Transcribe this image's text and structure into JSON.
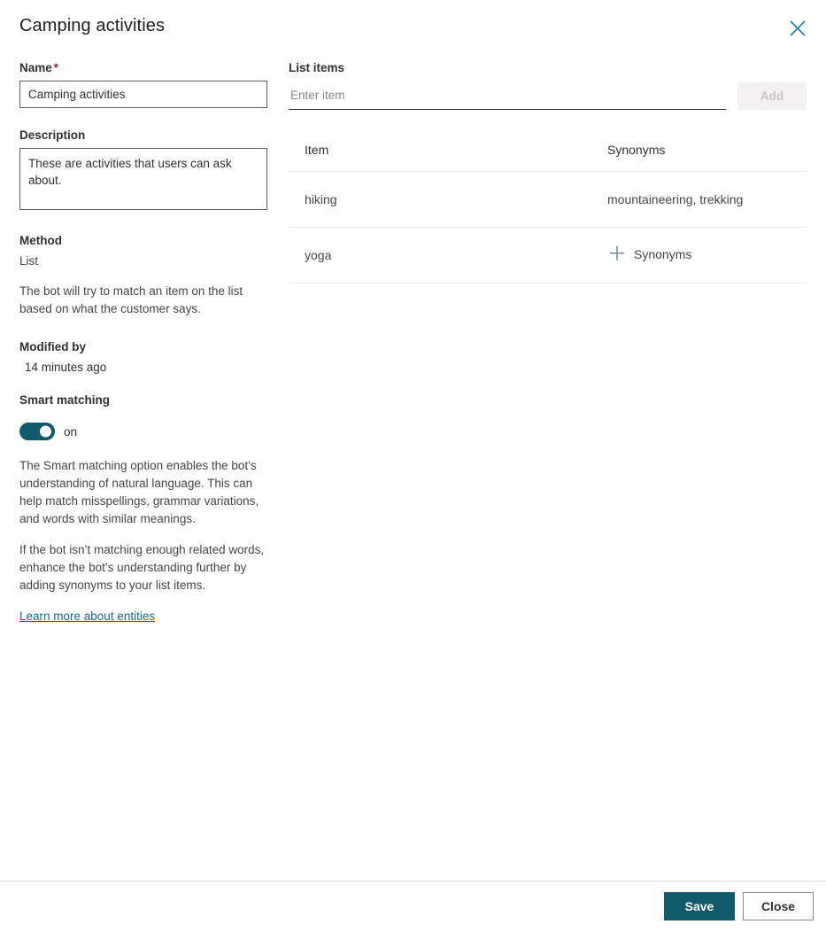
{
  "header": {
    "title": "Camping activities",
    "close_icon": "close-icon"
  },
  "left": {
    "name": {
      "label": "Name",
      "required_marker": "*",
      "value": "Camping activities"
    },
    "description": {
      "label": "Description",
      "value": "These are activities that users can ask about."
    },
    "method": {
      "label": "Method",
      "value": "List",
      "help": "The bot will try to match an item on the list based on what the customer says."
    },
    "modified": {
      "label": "Modified by",
      "value": "14 minutes ago"
    },
    "smart_matching": {
      "label": "Smart matching",
      "toggle_state": "on",
      "paragraph_1": "The Smart matching option enables the bot’s understanding of natural language. This can help match misspellings, grammar variations, and words with similar meanings.",
      "paragraph_2": "If the bot isn’t matching enough related words, enhance the bot’s understanding further by adding synonyms to your list items.",
      "link_text": "Learn more about entities"
    }
  },
  "right": {
    "list_items": {
      "label": "List items",
      "input_placeholder": "Enter item",
      "input_value": "",
      "add_label": "Add"
    },
    "table": {
      "columns": [
        "Item",
        "Synonyms"
      ],
      "rows": [
        {
          "item": "hiking",
          "synonyms": "mountaineering, trekking",
          "has_add": false
        },
        {
          "item": "yoga",
          "synonyms": "Synonyms",
          "has_add": true
        }
      ]
    }
  },
  "footer": {
    "save_label": "Save",
    "close_label": "Close"
  },
  "colors": {
    "accent": "#0f5b6b",
    "link": "#0f6c8c",
    "close_icon": "#1b7ba6",
    "required": "#a4262c",
    "plus": "#6f8e9b"
  }
}
